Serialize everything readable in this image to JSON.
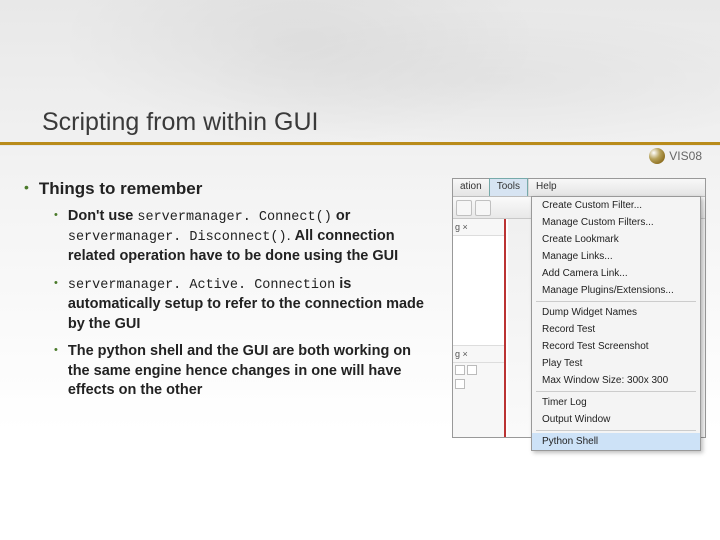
{
  "title": "Scripting from within GUI",
  "logo_text": "VIS08",
  "heading": "Things to remember",
  "bullets": [
    {
      "prefix_bold": "Don't use ",
      "code1": "servermanager. Connect()",
      "mid_bold": " or ",
      "code2": "servermanager. Disconnect()",
      "dot": ". ",
      "tail_bold": "All connection related operation have to be done using the GUI"
    },
    {
      "code1": "servermanager. Active. Connection",
      "tail_bold": " is automatically setup to refer to the connection made by the GUI"
    },
    {
      "tail_bold": "The python shell and the GUI are both working on the same engine hence changes in one will have effects on the other"
    }
  ],
  "menubar": {
    "items": [
      "ation",
      "Tools",
      "Help"
    ]
  },
  "dropdown": {
    "groups": [
      [
        "Create Custom Filter...",
        "Manage Custom Filters...",
        "Create Lookmark",
        "Manage Links...",
        "Add Camera Link...",
        "Manage Plugins/Extensions..."
      ],
      [
        "Dump Widget Names",
        "Record Test",
        "Record Test Screenshot",
        "Play Test",
        "Max Window Size: 300x 300"
      ],
      [
        "Timer Log",
        "Output Window"
      ],
      [
        "Python Shell"
      ]
    ],
    "highlight": "Python Shell"
  },
  "panel_tag": "g ×"
}
